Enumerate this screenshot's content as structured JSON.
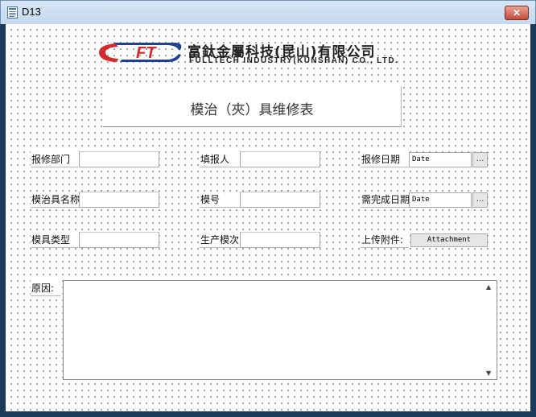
{
  "window": {
    "title": "D13",
    "close_label": "✕"
  },
  "logo": {
    "mark_text": "FT",
    "company_cn": "富鈦金屬科技(昆山)有限公司",
    "company_en": "FULLTECH INDUSTRY(KUNSHAN) CO., LTD."
  },
  "form": {
    "title": "模治（夾）具维修表",
    "fields": {
      "repair_dept_label": "报修部门",
      "reporter_label": "填报人",
      "repair_date_label": "报修日期",
      "repair_date_value": "Date",
      "fixture_name_label": "模治具名称",
      "mold_no_label": "模号",
      "due_date_label": "需完成日期",
      "due_date_value": "Date",
      "fixture_type_label": "模具类型",
      "production_count_label": "生产模次",
      "attachment_label": "上传附件:",
      "attachment_button": "Attachment",
      "reason_label": "原因:"
    },
    "picker_button": "..."
  },
  "colors": {
    "accent_red": "#d42a2a",
    "accent_blue": "#1f3f9c",
    "title_bar": "#c4d8ee"
  },
  "icons": [
    "document-icon",
    "close-icon",
    "calendar-picker-icon",
    "scroll-up-icon",
    "scroll-down-icon"
  ]
}
